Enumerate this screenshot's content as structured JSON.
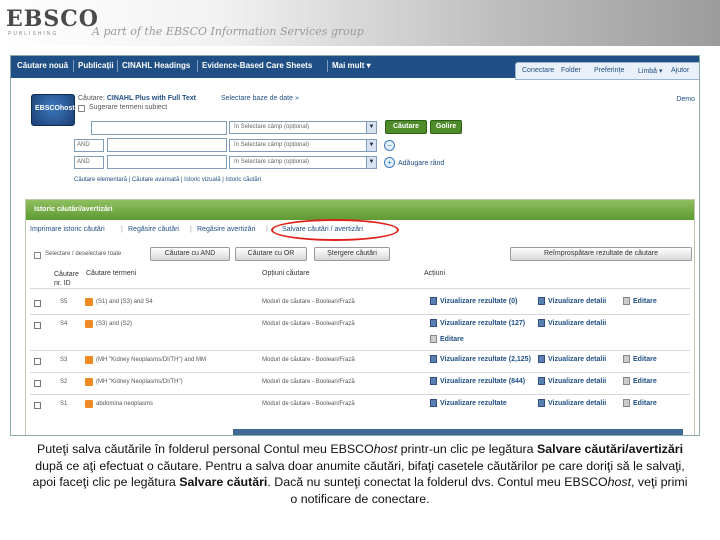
{
  "brand": {
    "logo": "EBSCO",
    "logo_sub": "PUBLISHING",
    "tagline": "A part of the EBSCO Information Services group"
  },
  "topnav": {
    "items": [
      "Căutare nouă",
      "Publicații",
      "CINAHL Headings",
      "Evidence-Based Care Sheets",
      "Mai mult ▾"
    ],
    "util": [
      "Conectare",
      "Folder",
      "Preferințe",
      "Limbă ▾",
      "Ajutor"
    ]
  },
  "search": {
    "badge": "EBSCOhost",
    "searching_label": "Căutare:",
    "database": "CINAHL Plus with Full Text",
    "choose_db": "Selectare baze de date »",
    "suggest_label": "Sugerare termeni subiect",
    "demo": "Demo",
    "field_select": "în  Selectare câmp (opțional)",
    "bool_ops": [
      "AND",
      "AND"
    ],
    "search_button": "Căutare",
    "clear_button": "Golire",
    "add_row": "Adăugare rând",
    "links": "Căutare elementară  |  Căutare avansată  |  Istoric vizuală  |  Istoric căutări"
  },
  "history": {
    "header": "Istoric căutări/avertizări",
    "links": [
      "Imprimare istoric căutări",
      "Regăsire căutări",
      "Regăsire avertizări",
      "Salvare căutări / avertizări"
    ],
    "select_all": "Selectare / deselectare toate",
    "buttons": [
      "Căutare cu AND",
      "Căutare cu OR",
      "Ștergere căutări"
    ],
    "refresh_button": "Reîmprospătare rezultate de căutare",
    "columns": [
      "Căutare nr. ID",
      "Căutare termeni",
      "Opțiuni căutare",
      "Acțiuni"
    ],
    "rows": [
      {
        "id": "S5",
        "terms": "(S1) and (S3) and S4",
        "options": "Moduri de căutare - Boolean/Frază",
        "actions": [
          "Vizualizare rezultate (0)",
          "Vizualizare detalii",
          "Editare"
        ]
      },
      {
        "id": "S4",
        "terms": "(S3) and (S2)",
        "options": "Moduri de căutare - Boolean/Frază",
        "actions": [
          "Vizualizare rezultate (127)",
          "Vizualizare detalii",
          "Editare"
        ]
      },
      {
        "id": "S3",
        "terms": "(MH \"Kidney Neoplasms/DI/TH\") and MM",
        "options": "Moduri de căutare - Boolean/Frază",
        "actions": [
          "Vizualizare rezultate (2,125)",
          "Vizualizare detalii",
          "Editare"
        ]
      },
      {
        "id": "S2",
        "terms": "(MH \"Kidney Neoplasms/DI/TH\")",
        "options": "Moduri de căutare - Boolean/Frază",
        "actions": [
          "Vizualizare rezultate (844)",
          "Vizualizare detalii",
          "Editare"
        ]
      },
      {
        "id": "S1",
        "terms": "abdomina neoplasms",
        "options": "Moduri de căutare - Boolean/Frază",
        "actions": [
          "Vizualizare rezultate",
          "Vizualizare detalii",
          "Editare"
        ]
      }
    ],
    "extra_action": "Editare"
  },
  "caption": {
    "p1": "Puteţi salva căutările în folderul personal Contul meu EBSCO",
    "p1_italic": "host",
    "p2": " printr-un clic pe legătura ",
    "p2_bold": "Salvare căutări/avertizări",
    "p3": " după ce aţi efectuat o căutare. Pentru a salva doar anumite căutări, bifaţi casetele căutărilor pe care doriţi să le salvaţi, apoi faceţi clic pe legătura ",
    "p3_bold": "Salvare căutări",
    "p4": ". Dacă nu sunteţi conectat la folderul dvs. Contul meu EBSCO",
    "p4_italic": "host",
    "p5": ", veţi primi o notificare de conectare."
  },
  "colors": {
    "nav": "#1f4f84",
    "green": "#4e8b2a",
    "highlight": "#e0211b"
  }
}
